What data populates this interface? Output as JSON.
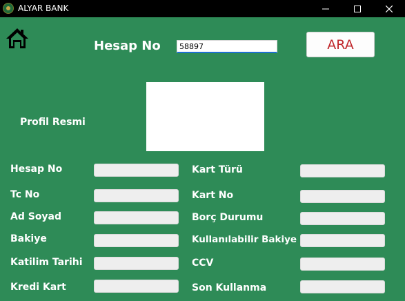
{
  "window": {
    "title": "ALYAR BANK"
  },
  "search": {
    "label": "Hesap No",
    "value": "58897",
    "button_label": "ARA"
  },
  "profile": {
    "label": "Profil Resmi"
  },
  "left_fields": [
    {
      "label": "Hesap No",
      "value": ""
    },
    {
      "label": "Tc No",
      "value": ""
    },
    {
      "label": "Ad Soyad",
      "value": ""
    },
    {
      "label": "Bakiye",
      "value": ""
    },
    {
      "label": "Katilim Tarihi",
      "value": ""
    },
    {
      "label": "Kredi Kart",
      "value": ""
    }
  ],
  "right_fields": [
    {
      "label": "Kart Türü",
      "value": ""
    },
    {
      "label": "Kart No",
      "value": ""
    },
    {
      "label": "Borç Durumu",
      "value": ""
    },
    {
      "label": "Kullanılabilir Bakiye",
      "value": ""
    },
    {
      "label": "CCV",
      "value": ""
    },
    {
      "label": "Son Kullanma",
      "value": ""
    }
  ],
  "colors": {
    "background": "#2e8b57",
    "titlebar": "#000000",
    "button_text": "#c0262a"
  }
}
